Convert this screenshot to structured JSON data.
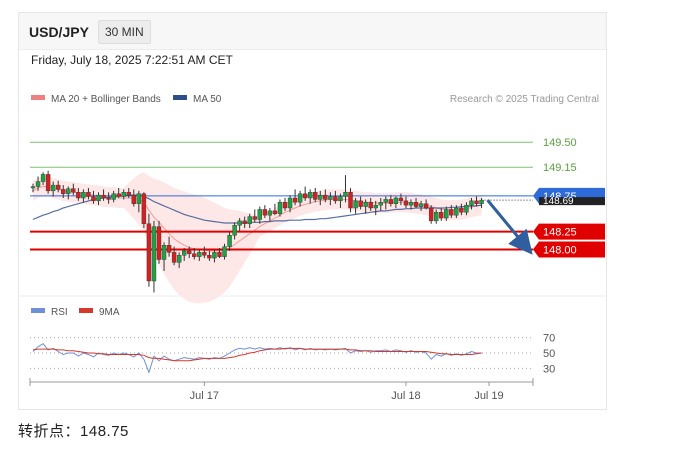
{
  "header": {
    "symbol": "USD/JPY",
    "timeframe": "30 MIN"
  },
  "datetime": "Friday, July 18, 2025 7:22:51 AM CET",
  "legend": {
    "bb": "MA 20 + Bollinger Bands",
    "ma50": "MA 50",
    "credit": "Research © 2025 Trading Central"
  },
  "rsi_legend": {
    "rsi": "RSI",
    "ma9": "9MA"
  },
  "turning_point": {
    "label": "转折点：",
    "value": "148.75"
  },
  "colors": {
    "bb": "#f08080",
    "ma50": "#2d4e8a",
    "green_level": "#7cc070",
    "red_level": "#e00000",
    "pivot": "#2f6bd8",
    "up": "#22a045",
    "down": "#d42020",
    "rsi": "#6f8fd8",
    "rsi_ma": "#d33a2c",
    "arrow": "#2f5f9f"
  },
  "chart_data": [
    {
      "type": "line",
      "title": "USD/JPY",
      "ylim": [
        147.35,
        149.95
      ],
      "x_ticks": [
        "Jul 17",
        "Jul 18",
        "Jul 19"
      ],
      "levels": [
        {
          "value": 149.5,
          "label": "149.50",
          "kind": "resistance"
        },
        {
          "value": 149.15,
          "label": "149.15",
          "kind": "resistance"
        },
        {
          "value": 148.75,
          "label": "148.75",
          "kind": "pivot"
        },
        {
          "value": 148.25,
          "label": "148.25",
          "kind": "support"
        },
        {
          "value": 148.0,
          "label": "148.00",
          "kind": "support"
        }
      ],
      "last_price": 148.69,
      "last_price_label": "148.69",
      "forecast": {
        "direction": "down",
        "to": 148.0
      },
      "series": [
        {
          "name": "Price",
          "ohlc": [
            [
              148.86,
              148.92,
              148.8,
              148.88
            ],
            [
              148.88,
              149.02,
              148.82,
              148.95
            ],
            [
              148.95,
              149.08,
              148.9,
              149.05
            ],
            [
              149.05,
              149.1,
              148.78,
              148.82
            ],
            [
              148.82,
              148.95,
              148.74,
              148.9
            ],
            [
              148.9,
              148.96,
              148.8,
              148.84
            ],
            [
              148.84,
              148.9,
              148.72,
              148.78
            ],
            [
              148.78,
              148.88,
              148.7,
              148.85
            ],
            [
              148.85,
              148.92,
              148.76,
              148.8
            ],
            [
              148.8,
              148.86,
              148.68,
              148.72
            ],
            [
              148.72,
              148.84,
              148.66,
              148.8
            ],
            [
              148.8,
              148.86,
              148.7,
              148.74
            ],
            [
              148.74,
              148.82,
              148.64,
              148.68
            ],
            [
              148.68,
              148.8,
              148.62,
              148.76
            ],
            [
              148.76,
              148.84,
              148.68,
              148.72
            ],
            [
              148.72,
              148.8,
              148.64,
              148.7
            ],
            [
              148.7,
              148.82,
              148.66,
              148.78
            ],
            [
              148.78,
              148.86,
              148.72,
              148.74
            ],
            [
              148.74,
              148.84,
              148.7,
              148.8
            ],
            [
              148.8,
              148.86,
              148.72,
              148.76
            ],
            [
              148.76,
              148.84,
              148.6,
              148.64
            ],
            [
              148.64,
              148.82,
              148.52,
              148.78
            ],
            [
              148.78,
              148.8,
              148.3,
              148.36
            ],
            [
              148.36,
              148.5,
              147.48,
              147.56
            ],
            [
              147.56,
              148.4,
              147.4,
              148.32
            ],
            [
              148.32,
              148.4,
              147.8,
              147.86
            ],
            [
              147.86,
              148.1,
              147.7,
              148.06
            ],
            [
              148.06,
              148.18,
              147.9,
              147.96
            ],
            [
              147.96,
              148.04,
              147.78,
              147.82
            ],
            [
              147.82,
              147.96,
              147.74,
              147.92
            ],
            [
              147.92,
              148.02,
              147.84,
              147.98
            ],
            [
              147.98,
              148.04,
              147.88,
              147.94
            ],
            [
              147.94,
              148.02,
              147.86,
              147.9
            ],
            [
              147.9,
              148.0,
              147.84,
              147.96
            ],
            [
              147.96,
              148.04,
              147.88,
              147.92
            ],
            [
              147.92,
              147.98,
              147.84,
              147.88
            ],
            [
              147.88,
              148.0,
              147.82,
              147.96
            ],
            [
              147.96,
              148.02,
              147.88,
              147.9
            ],
            [
              147.9,
              148.08,
              147.86,
              148.04
            ],
            [
              148.04,
              148.24,
              147.98,
              148.2
            ],
            [
              148.2,
              148.38,
              148.14,
              148.34
            ],
            [
              148.34,
              148.44,
              148.26,
              148.4
            ],
            [
              148.4,
              148.46,
              148.3,
              148.36
            ],
            [
              148.36,
              148.5,
              148.3,
              148.46
            ],
            [
              148.46,
              148.56,
              148.38,
              148.42
            ],
            [
              148.42,
              148.6,
              148.36,
              148.56
            ],
            [
              148.56,
              148.62,
              148.44,
              148.48
            ],
            [
              148.48,
              148.58,
              148.4,
              148.54
            ],
            [
              148.54,
              148.64,
              148.48,
              148.5
            ],
            [
              148.5,
              148.7,
              148.46,
              148.66
            ],
            [
              148.66,
              148.72,
              148.54,
              148.58
            ],
            [
              148.58,
              148.76,
              148.52,
              148.72
            ],
            [
              148.72,
              148.84,
              148.62,
              148.66
            ],
            [
              148.66,
              148.82,
              148.6,
              148.78
            ],
            [
              148.78,
              148.88,
              148.68,
              148.72
            ],
            [
              148.72,
              148.84,
              148.64,
              148.8
            ],
            [
              148.8,
              148.86,
              148.66,
              148.7
            ],
            [
              148.7,
              148.82,
              148.62,
              148.76
            ],
            [
              148.76,
              148.84,
              148.66,
              148.7
            ],
            [
              148.7,
              148.8,
              148.62,
              148.74
            ],
            [
              148.74,
              148.82,
              148.64,
              148.68
            ],
            [
              148.68,
              148.78,
              148.58,
              148.74
            ],
            [
              148.74,
              149.04,
              148.66,
              148.8
            ],
            [
              148.8,
              148.86,
              148.52,
              148.58
            ],
            [
              148.58,
              148.72,
              148.5,
              148.68
            ],
            [
              148.68,
              148.74,
              148.56,
              148.6
            ],
            [
              148.6,
              148.7,
              148.5,
              148.66
            ],
            [
              148.66,
              148.72,
              148.54,
              148.58
            ],
            [
              148.58,
              148.68,
              148.48,
              148.62
            ],
            [
              148.62,
              148.72,
              148.54,
              148.66
            ],
            [
              148.66,
              148.74,
              148.56,
              148.7
            ],
            [
              148.7,
              148.76,
              148.6,
              148.64
            ],
            [
              148.64,
              148.74,
              148.58,
              148.72
            ],
            [
              148.72,
              148.78,
              148.62,
              148.68
            ],
            [
              148.68,
              148.74,
              148.58,
              148.62
            ],
            [
              148.62,
              148.7,
              148.56,
              148.66
            ],
            [
              148.66,
              148.72,
              148.58,
              148.6
            ],
            [
              148.6,
              148.68,
              148.54,
              148.64
            ],
            [
              148.64,
              148.7,
              148.56,
              148.58
            ],
            [
              148.58,
              148.62,
              148.36,
              148.4
            ],
            [
              148.4,
              148.56,
              148.36,
              148.52
            ],
            [
              148.52,
              148.58,
              148.4,
              148.44
            ],
            [
              148.44,
              148.6,
              148.4,
              148.56
            ],
            [
              148.56,
              148.62,
              148.44,
              148.48
            ],
            [
              148.48,
              148.62,
              148.44,
              148.58
            ],
            [
              148.58,
              148.64,
              148.48,
              148.52
            ],
            [
              148.52,
              148.66,
              148.48,
              148.62
            ],
            [
              148.62,
              148.72,
              148.56,
              148.68
            ],
            [
              148.68,
              148.74,
              148.6,
              148.64
            ],
            [
              148.64,
              148.72,
              148.58,
              148.69
            ]
          ]
        },
        {
          "name": "MA 20 + Bollinger Bands",
          "values": [
            148.82,
            148.86,
            148.88,
            148.88,
            148.86,
            148.84,
            148.82,
            148.81,
            148.8,
            148.79,
            148.78,
            148.77,
            148.76,
            148.75,
            148.74,
            148.73,
            148.73,
            148.72,
            148.72,
            148.72,
            148.71,
            148.7,
            148.66,
            148.55,
            148.45,
            148.38,
            148.3,
            148.22,
            148.15,
            148.1,
            148.06,
            148.03,
            148.01,
            148.0,
            147.99,
            147.98,
            147.98,
            147.98,
            147.99,
            148.02,
            148.07,
            148.12,
            148.17,
            148.22,
            148.27,
            148.32,
            148.36,
            148.4,
            148.44,
            148.48,
            148.52,
            148.55,
            148.58,
            148.61,
            148.63,
            148.65,
            148.67,
            148.68,
            148.69,
            148.7,
            148.7,
            148.7,
            148.7,
            148.69,
            148.68,
            148.67,
            148.66,
            148.66,
            148.65,
            148.65,
            148.65,
            148.65,
            148.66,
            148.66,
            148.66,
            148.65,
            148.64,
            148.63,
            148.62,
            148.6,
            148.58,
            148.56,
            148.55,
            148.55,
            148.55,
            148.56,
            148.57,
            148.59,
            148.61,
            148.62
          ]
        },
        {
          "name": "MA 50",
          "values": [
            148.42,
            148.45,
            148.48,
            148.5,
            148.53,
            148.55,
            148.58,
            148.6,
            148.62,
            148.64,
            148.66,
            148.68,
            148.7,
            148.71,
            148.72,
            148.73,
            148.74,
            148.75,
            148.75,
            148.76,
            148.76,
            148.76,
            148.74,
            148.71,
            148.67,
            148.64,
            148.61,
            148.58,
            148.55,
            148.52,
            148.49,
            148.47,
            148.45,
            148.43,
            148.41,
            148.4,
            148.39,
            148.38,
            148.37,
            148.37,
            148.37,
            148.37,
            148.37,
            148.38,
            148.38,
            148.38,
            148.39,
            148.39,
            148.4,
            148.4,
            148.4,
            148.41,
            148.41,
            148.41,
            148.42,
            148.42,
            148.42,
            148.43,
            148.43,
            148.44,
            148.45,
            148.46,
            148.47,
            148.48,
            148.49,
            148.5,
            148.51,
            148.52,
            148.53,
            148.54,
            148.54,
            148.55,
            148.56,
            148.56,
            148.57,
            148.57,
            148.58,
            148.58,
            148.58,
            148.58,
            148.58,
            148.58,
            148.58,
            148.59,
            148.59,
            148.6,
            148.6,
            148.61,
            148.61,
            148.62
          ]
        }
      ]
    },
    {
      "type": "line",
      "title": "RSI",
      "ylim": [
        15,
        85
      ],
      "y_ticks": [
        70,
        50,
        30
      ],
      "series": [
        {
          "name": "RSI",
          "values": [
            52,
            58,
            62,
            54,
            56,
            52,
            48,
            50,
            50,
            46,
            50,
            48,
            45,
            50,
            48,
            47,
            50,
            48,
            50,
            48,
            45,
            50,
            42,
            25,
            46,
            40,
            46,
            42,
            40,
            42,
            44,
            43,
            42,
            44,
            43,
            42,
            44,
            43,
            46,
            50,
            54,
            56,
            55,
            57,
            55,
            57,
            55,
            56,
            55,
            57,
            55,
            57,
            54,
            56,
            54,
            56,
            54,
            55,
            54,
            55,
            54,
            55,
            56,
            50,
            53,
            52,
            53,
            51,
            53,
            53,
            54,
            52,
            54,
            53,
            51,
            53,
            51,
            52,
            50,
            42,
            48,
            46,
            49,
            47,
            49,
            47,
            49,
            52,
            50,
            50
          ]
        },
        {
          "name": "9MA",
          "values": [
            54,
            55,
            55,
            55,
            55,
            54,
            54,
            53,
            53,
            52,
            51,
            50,
            50,
            49,
            49,
            48,
            48,
            48,
            48,
            48,
            48,
            48,
            47,
            44,
            43,
            43,
            42,
            41,
            40,
            40,
            40,
            40,
            41,
            42,
            43,
            43,
            43,
            43,
            43,
            44,
            45,
            47,
            48,
            50,
            51,
            53,
            54,
            55,
            55,
            55,
            56,
            56,
            56,
            56,
            55,
            55,
            55,
            55,
            55,
            55,
            55,
            55,
            55,
            54,
            54,
            53,
            53,
            53,
            52,
            52,
            52,
            52,
            52,
            52,
            52,
            52,
            52,
            52,
            52,
            51,
            50,
            49,
            49,
            48,
            48,
            48,
            48,
            48,
            49,
            50
          ]
        }
      ]
    }
  ]
}
